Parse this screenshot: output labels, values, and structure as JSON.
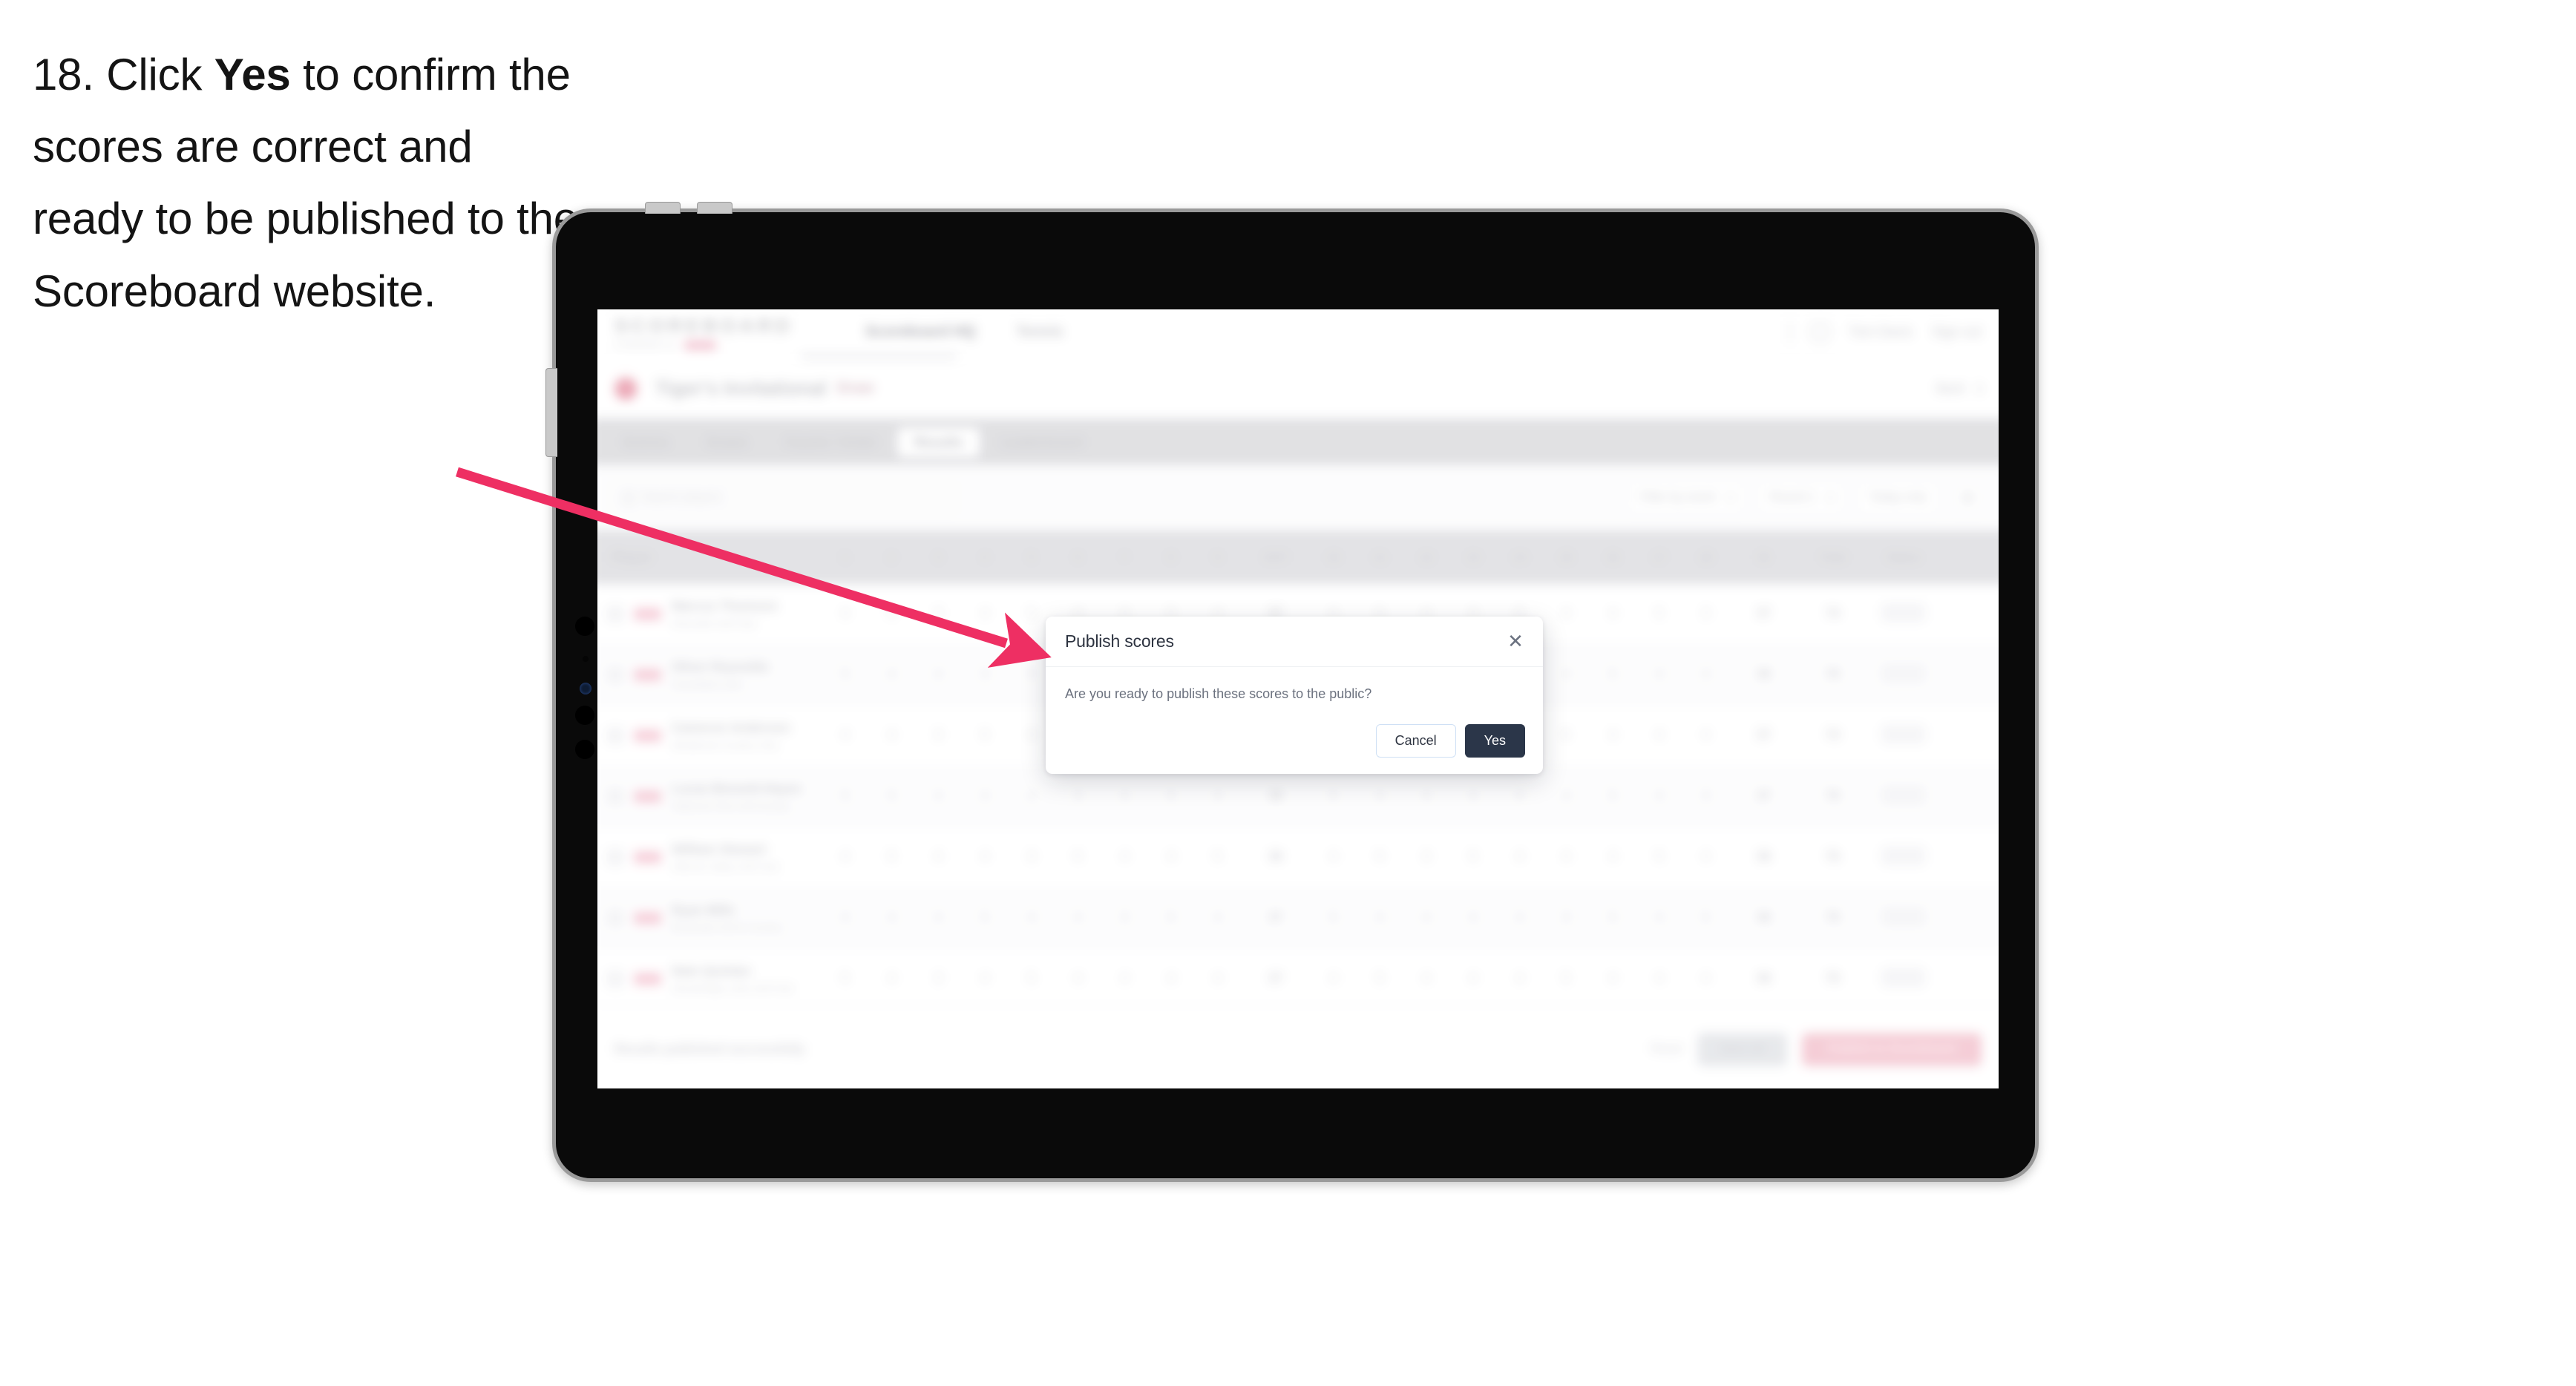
{
  "instruction": {
    "step_number": "18.",
    "text_before": " Click ",
    "bold_word": "Yes",
    "text_after": " to confirm the scores are correct and ready to be published to the Scoreboard website."
  },
  "colors": {
    "arrow": "#EE2F63",
    "modal_primary_button": "#2B3649",
    "brand_accent": "#F2889F",
    "publish_button": "#F9B9C8"
  },
  "modal": {
    "name": "publish-scores-dialog",
    "title": "Publish scores",
    "message": "Are you ready to publish these scores to the public?",
    "close_icon": "close-icon",
    "cancel_label": "Cancel",
    "confirm_label": "Yes"
  },
  "app": {
    "brand": {
      "wordmark": "SCOREBOARD",
      "tagline": "POWERED BY"
    },
    "topnav": [
      {
        "label": "Scoreboard HQ",
        "active": true
      },
      {
        "label": "Tennis",
        "active": false
      }
    ],
    "topbar_right": [
      {
        "label": "Tom Davis"
      },
      {
        "label": "Sign out"
      }
    ],
    "event": {
      "title": "Tiger's Invitational",
      "subtitle": "Draw",
      "right_label": "Back"
    },
    "tabs": [
      {
        "label": "Entries",
        "selected": false
      },
      {
        "label": "Draws",
        "selected": false
      },
      {
        "label": "Courts / Order",
        "selected": false
      },
      {
        "label": "Results",
        "selected": true
      },
      {
        "label": "Leaderboard",
        "selected": false
      }
    ],
    "filters": {
      "search_placeholder": "Search players",
      "dropdowns": [
        {
          "label": "Filter by event"
        },
        {
          "label": "Round 1"
        }
      ],
      "secondary_button": "Today only",
      "icon_button": "list-view-icon"
    },
    "table": {
      "columns": [
        {
          "key": "player",
          "label": "Player",
          "type": "player"
        },
        {
          "key": "h1",
          "label": "1",
          "type": "num"
        },
        {
          "key": "h2",
          "label": "2",
          "type": "num"
        },
        {
          "key": "h3",
          "label": "3",
          "type": "num"
        },
        {
          "key": "h4",
          "label": "4",
          "type": "num"
        },
        {
          "key": "h5",
          "label": "5",
          "type": "num"
        },
        {
          "key": "h6",
          "label": "6",
          "type": "num"
        },
        {
          "key": "h7",
          "label": "7",
          "type": "num"
        },
        {
          "key": "h8",
          "label": "8",
          "type": "num"
        },
        {
          "key": "h9",
          "label": "9",
          "type": "num"
        },
        {
          "key": "out",
          "label": "OUT",
          "type": "wide"
        },
        {
          "key": "h10",
          "label": "10",
          "type": "num"
        },
        {
          "key": "h11",
          "label": "11",
          "type": "num"
        },
        {
          "key": "h12",
          "label": "12",
          "type": "num"
        },
        {
          "key": "h13",
          "label": "13",
          "type": "num"
        },
        {
          "key": "h14",
          "label": "14",
          "type": "num"
        },
        {
          "key": "h15",
          "label": "15",
          "type": "num"
        },
        {
          "key": "h16",
          "label": "16",
          "type": "num"
        },
        {
          "key": "h17",
          "label": "17",
          "type": "num"
        },
        {
          "key": "h18",
          "label": "18",
          "type": "num"
        },
        {
          "key": "in",
          "label": "IN",
          "type": "wide"
        },
        {
          "key": "total",
          "label": "Total",
          "type": "wide"
        },
        {
          "key": "status",
          "label": "Status",
          "type": "end"
        }
      ],
      "rows": [
        {
          "player": "Marcus Thomson",
          "club": "Riverside Golf Club",
          "scores": [
            "4",
            "5",
            "3",
            "4",
            "5",
            "4",
            "3",
            "5",
            "4"
          ],
          "out": "37",
          "scores_in": [
            "4",
            "5",
            "4",
            "3",
            "5",
            "4",
            "4",
            "5",
            "3"
          ],
          "in": "37",
          "total": "74"
        },
        {
          "player": "Oliver Reynolds",
          "club": "Greenfield Links",
          "scores": [
            "5",
            "4",
            "4",
            "3",
            "5",
            "4",
            "4",
            "4",
            "5"
          ],
          "out": "38",
          "scores_in": [
            "5",
            "4",
            "3",
            "4",
            "5",
            "4",
            "5",
            "4",
            "4"
          ],
          "in": "38",
          "total": "76"
        },
        {
          "player": "Cameron Anderson",
          "club": "Westbrook Country Club",
          "scores": [
            "4",
            "4",
            "3",
            "5",
            "4",
            "5",
            "3",
            "4",
            "4"
          ],
          "out": "36",
          "scores_in": [
            "4",
            "4",
            "4",
            "3",
            "5",
            "5",
            "4",
            "4",
            "4"
          ],
          "in": "37",
          "total": "73"
        },
        {
          "player": "Lucas Bennett-Hayes",
          "club": "Oakmont Park Golf Society",
          "scores": [
            "5",
            "5",
            "4",
            "4",
            "4",
            "3",
            "4",
            "5",
            "4"
          ],
          "out": "38",
          "scores_in": [
            "5",
            "4",
            "4",
            "4",
            "4",
            "4",
            "5",
            "4",
            "3"
          ],
          "in": "37",
          "total": "75"
        },
        {
          "player": "William Stewart",
          "club": "Hillcrest Valley Golf Club",
          "scores": [
            "4",
            "5",
            "4",
            "4",
            "3",
            "5",
            "4",
            "4",
            "5"
          ],
          "out": "38",
          "scores_in": [
            "4",
            "5",
            "3",
            "5",
            "4",
            "4",
            "4",
            "5",
            "4"
          ],
          "in": "38",
          "total": "76"
        },
        {
          "player": "Ryan Mills",
          "club": "Brookvale Golf & Country",
          "scores": [
            "4",
            "4",
            "4",
            "5",
            "4",
            "4",
            "3",
            "5",
            "4"
          ],
          "out": "37",
          "scores_in": [
            "5",
            "4",
            "4",
            "4",
            "4",
            "3",
            "5",
            "4",
            "5"
          ],
          "in": "38",
          "total": "75"
        },
        {
          "player": "Nate Quinlan",
          "club": "Stonebridge Links Golf Club",
          "scores": [
            "5",
            "4",
            "3",
            "4",
            "5",
            "4",
            "4",
            "4",
            "4"
          ],
          "out": "37",
          "scores_in": [
            "4",
            "5",
            "4",
            "4",
            "4",
            "5",
            "4",
            "4",
            "4"
          ],
          "in": "38",
          "total": "75"
        }
      ],
      "status_pills": [
        "Verified",
        "Final"
      ]
    },
    "footer": {
      "note": "Results published successfully",
      "link": "Reset",
      "secondary_button": "Save all",
      "primary_button": "Publish to Scoreboard"
    }
  },
  "device": {
    "type": "tablet"
  }
}
